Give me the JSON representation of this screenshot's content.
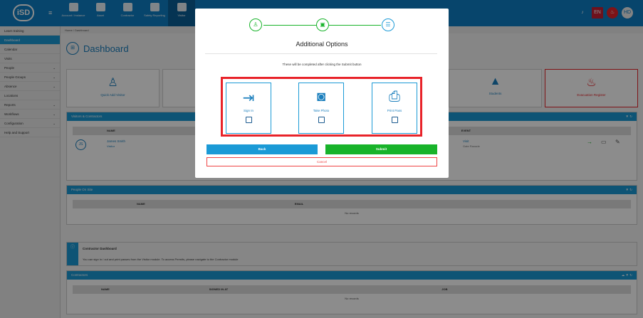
{
  "app": {
    "logo": "iSD",
    "hamburger": "≡",
    "lang": "EN",
    "user": "HD"
  },
  "topnav": [
    {
      "label": "Account / Instance",
      "icon": "account-icon"
    },
    {
      "label": "Asset",
      "icon": "asset-icon"
    },
    {
      "label": "Contractor",
      "icon": "contractor-icon"
    },
    {
      "label": "Safety Reporting",
      "icon": "safety-icon"
    },
    {
      "label": "Visitor",
      "icon": "visitor-icon"
    }
  ],
  "breadcrumb": "Home / Dashboard",
  "sidebar": [
    {
      "label": "Learn training"
    },
    {
      "label": "Dashboard"
    },
    {
      "label": "Calendar"
    },
    {
      "label": "Visits"
    },
    {
      "label": "People",
      "arrow": "⌄"
    },
    {
      "label": "People Groups",
      "arrow": "⌄"
    },
    {
      "label": "Absence",
      "arrow": "⌄"
    },
    {
      "label": "Locations"
    },
    {
      "label": "Reports",
      "arrow": "⌄"
    },
    {
      "label": "Workflows",
      "arrow": "⌄"
    },
    {
      "label": "Configuration",
      "arrow": "⌄"
    },
    {
      "label": "Help and Support"
    }
  ],
  "page_title": "Dashboard",
  "tiles": {
    "quick_add": "Quick Add Visitor",
    "students": "Students",
    "evacuation": "Evacuation Register"
  },
  "visitors_panel": {
    "title": "Visitors & Contractors",
    "col_name": "NAME",
    "col_event": "EVENT",
    "row": {
      "initials": "JS",
      "name": "James Smith",
      "type": "Visitor",
      "event": "Visit",
      "event_sub": "Gate Ranade"
    }
  },
  "people_panel": {
    "title": "People On Site",
    "col_name": "NAME",
    "col_email": "EMAIL",
    "empty": "No records"
  },
  "contractor_dash": {
    "title": "Contractor Dashboard",
    "text": "You can sign in / out and print passes from the Visitor module. To access Permits, please navigate to the Contractor module"
  },
  "contractors_panel": {
    "title": "Contractors",
    "col_name": "NAME",
    "col_signed": "SIGNED IN AT",
    "col_job": "JOB",
    "empty": "No records"
  },
  "modal": {
    "title": "Additional Options",
    "note": "These will be completed after clicking the Submit button",
    "options": [
      {
        "label": "Sign In",
        "icon": "sign-in-icon",
        "checked": false
      },
      {
        "label": "Take Photo",
        "icon": "camera-icon",
        "checked": false
      },
      {
        "label": "Print Pass",
        "icon": "printer-icon",
        "checked": false
      }
    ],
    "back": "Back",
    "submit": "Submit",
    "cancel": "Cancel",
    "steps": [
      {
        "icon": "person-icon",
        "state": "done"
      },
      {
        "icon": "badge-icon",
        "state": "done"
      },
      {
        "icon": "list-icon",
        "state": "active"
      }
    ]
  },
  "colors": {
    "primary": "#1b9ad6",
    "green": "#18b32a",
    "red": "#e8232a",
    "topbar": "#0d7ec5"
  }
}
